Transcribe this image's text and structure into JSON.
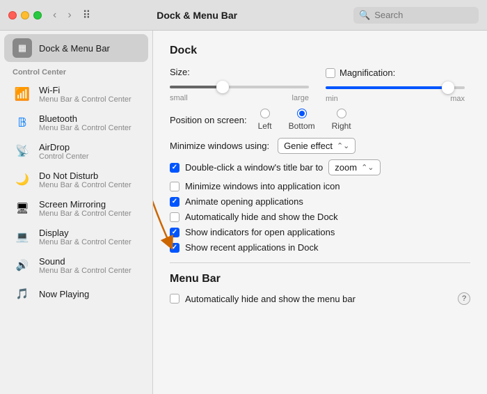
{
  "titlebar": {
    "title": "Dock & Menu Bar",
    "search_placeholder": "Search"
  },
  "sidebar": {
    "section_header": "Control Center",
    "active_item": {
      "label": "Dock & Menu Bar",
      "icon": "dock"
    },
    "items": [
      {
        "id": "wifi",
        "label": "Wi-Fi",
        "sublabel": "Menu Bar & Control Center",
        "icon": "wifi"
      },
      {
        "id": "bluetooth",
        "label": "Bluetooth",
        "sublabel": "Menu Bar & Control Center",
        "icon": "bluetooth"
      },
      {
        "id": "airdrop",
        "label": "AirDrop",
        "sublabel": "Control Center",
        "icon": "airdrop"
      },
      {
        "id": "donotdisturb",
        "label": "Do Not Disturb",
        "sublabel": "Menu Bar & Control Center",
        "icon": "donotdisturb"
      },
      {
        "id": "screenmirroring",
        "label": "Screen Mirroring",
        "sublabel": "Menu Bar & Control Center",
        "icon": "screenmirroring"
      },
      {
        "id": "display",
        "label": "Display",
        "sublabel": "Menu Bar & Control Center",
        "icon": "display"
      },
      {
        "id": "sound",
        "label": "Sound",
        "sublabel": "Menu Bar & Control Center",
        "icon": "sound"
      },
      {
        "id": "nowplaying",
        "label": "Now Playing",
        "sublabel": "",
        "icon": "nowplaying"
      }
    ]
  },
  "content": {
    "dock_section": "Dock",
    "size_label": "Size:",
    "size_small": "small",
    "size_large": "large",
    "magnification_label": "Magnification:",
    "mag_min": "min",
    "mag_max": "max",
    "position_label": "Position on screen:",
    "positions": [
      "Left",
      "Bottom",
      "Right"
    ],
    "selected_position": "Bottom",
    "minimize_label": "Minimize windows using:",
    "minimize_value": "Genie effect",
    "doubleclick_label": "Double-click a window's title bar to",
    "doubleclick_value": "zoom",
    "checkboxes": [
      {
        "id": "minimize_app",
        "label": "Minimize windows into application icon",
        "checked": false
      },
      {
        "id": "animate",
        "label": "Animate opening applications",
        "checked": true
      },
      {
        "id": "autohide",
        "label": "Automatically hide and show the Dock",
        "checked": false
      },
      {
        "id": "indicators",
        "label": "Show indicators for open applications",
        "checked": true
      },
      {
        "id": "recent",
        "label": "Show recent applications in Dock",
        "checked": true
      }
    ],
    "menubar_section": "Menu Bar",
    "menubar_checkbox": {
      "label": "Automatically hide and show the menu bar",
      "checked": false
    }
  }
}
